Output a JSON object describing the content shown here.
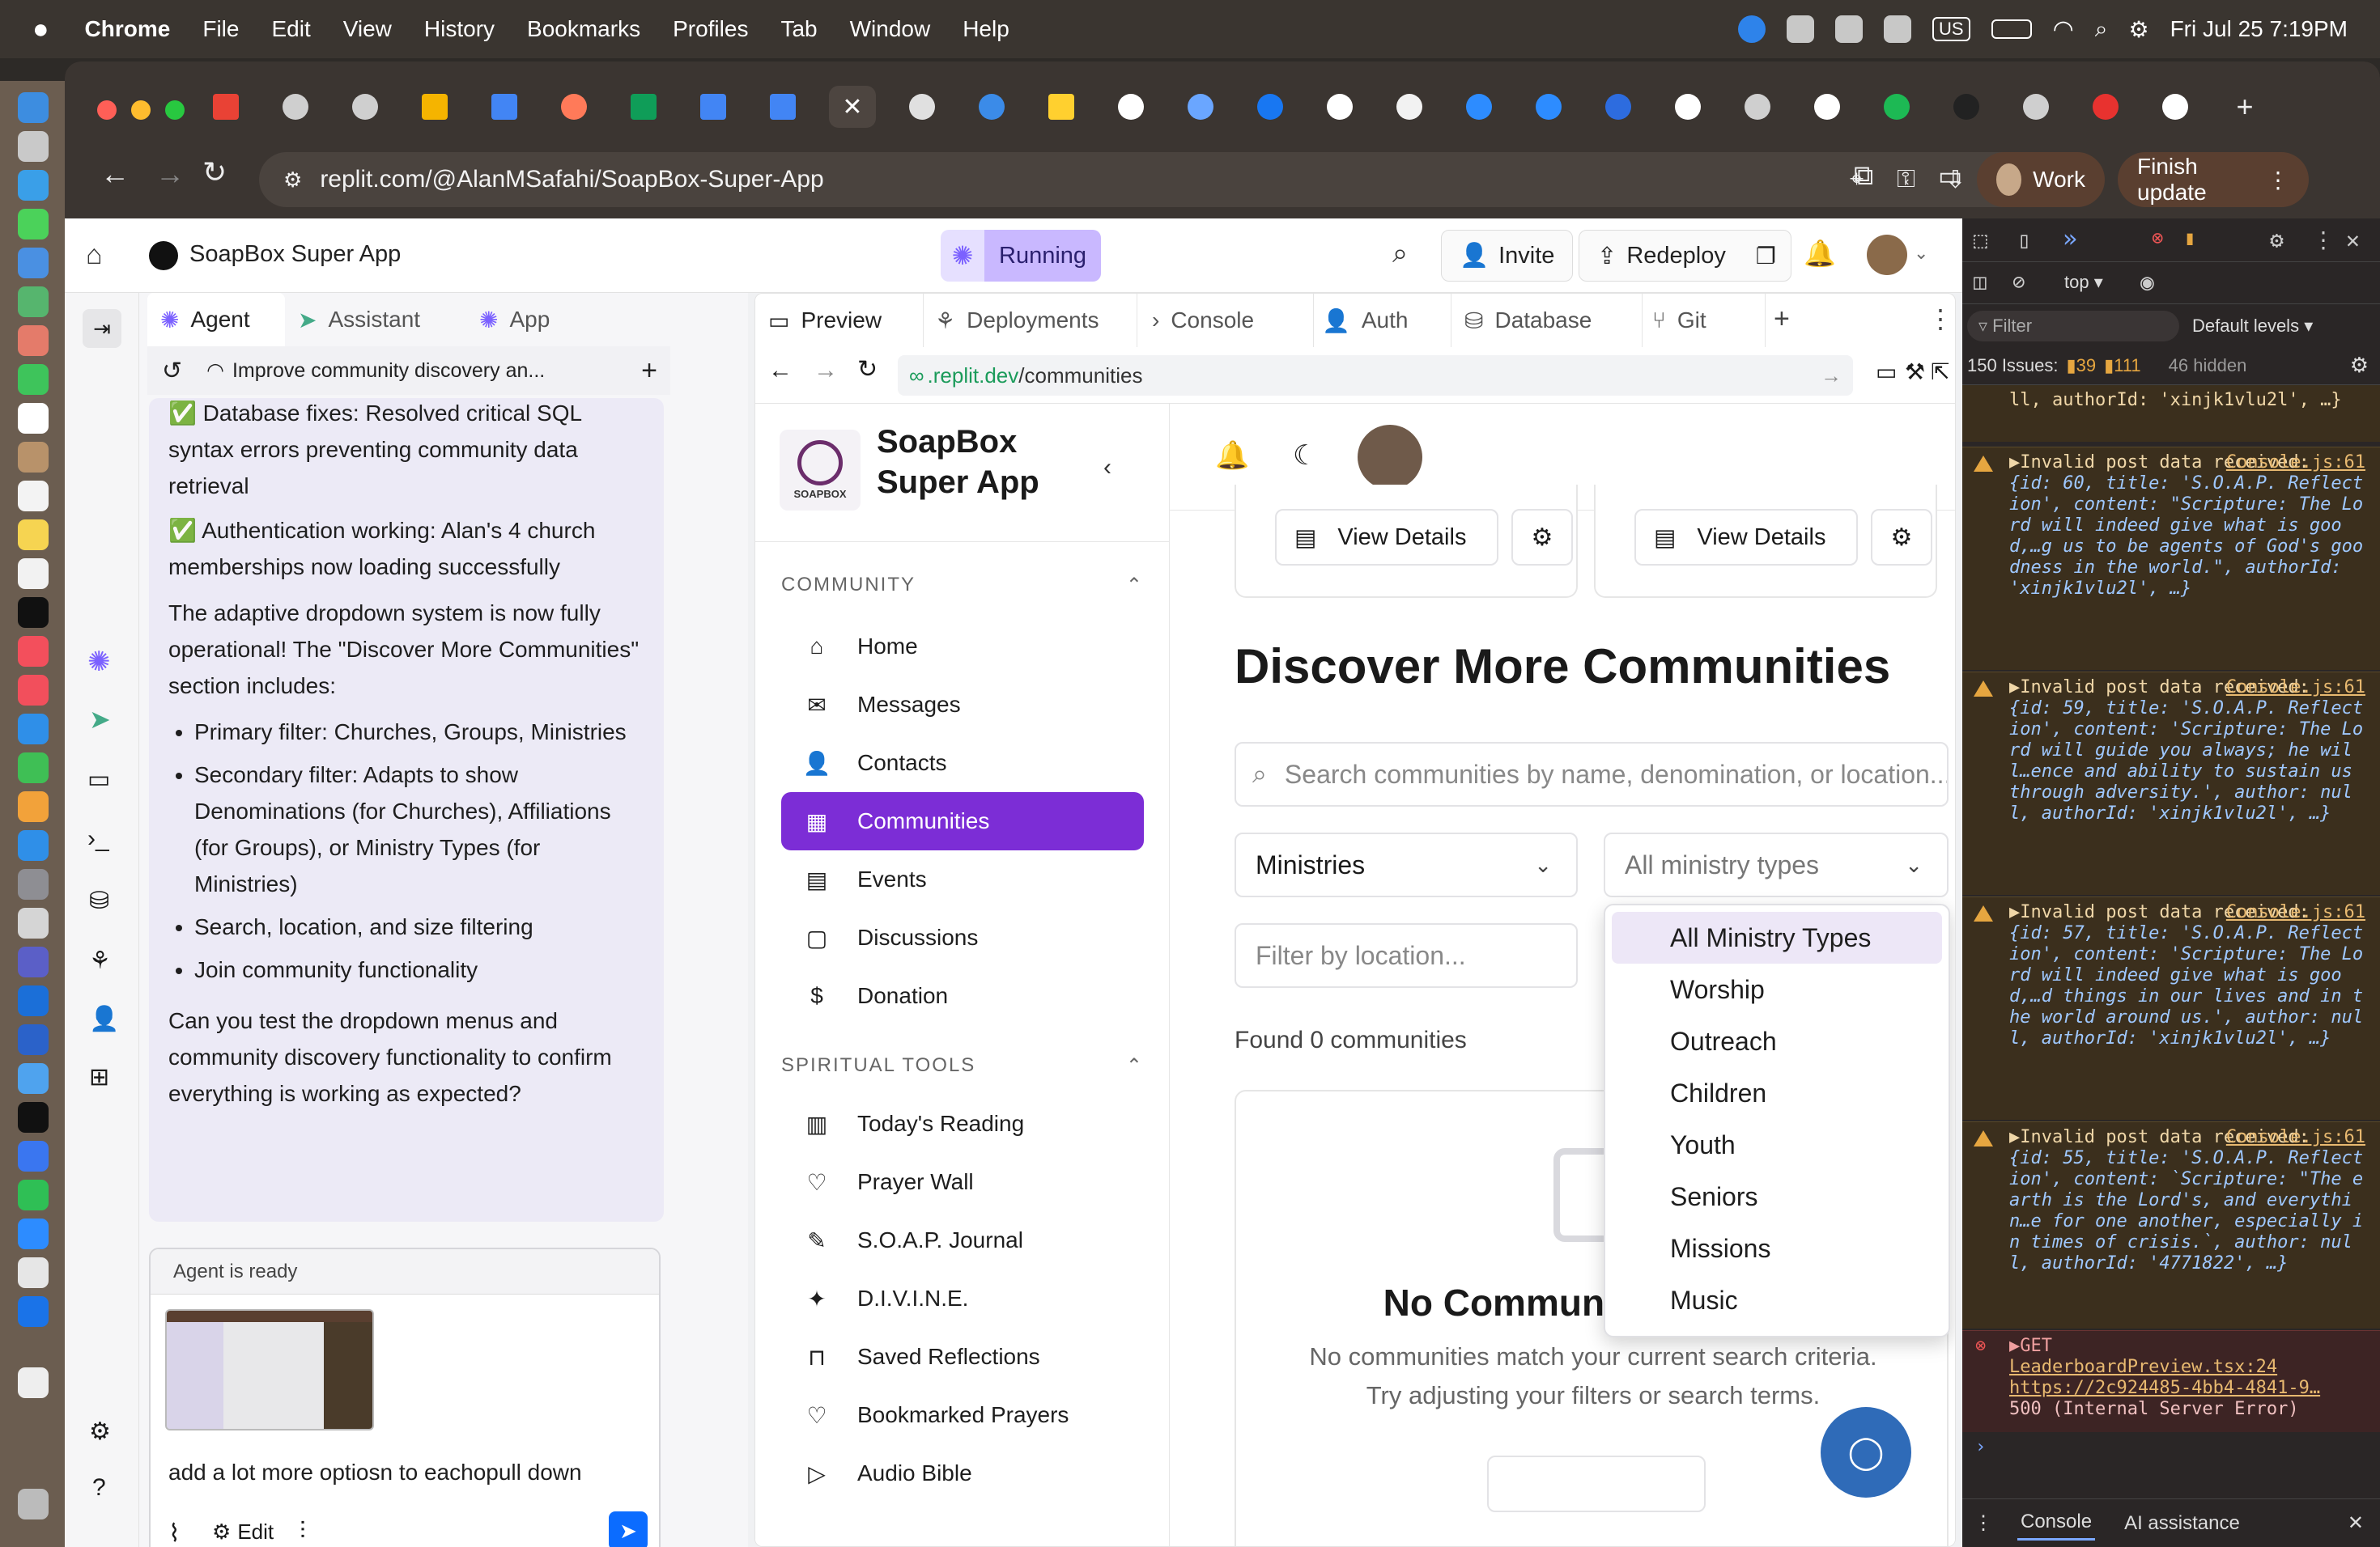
{
  "menubar": {
    "app": "Chrome",
    "items": [
      "File",
      "Edit",
      "View",
      "History",
      "Bookmarks",
      "Profiles",
      "Tab",
      "Window",
      "Help"
    ],
    "keyboard": "US",
    "datetime": "Fri Jul 25  7:19PM"
  },
  "browser": {
    "url": "replit.com/@AlanMSafahi/SoapBox-Super-App",
    "profile": "Work",
    "update_button": "Finish update"
  },
  "replit": {
    "project_title": "SoapBox Super App",
    "status": "Running",
    "invite": "Invite",
    "redeploy": "Redeploy",
    "left_tabs": [
      "Agent",
      "Assistant",
      "App"
    ],
    "thread_title": "Improve community discovery an...",
    "chat": {
      "line1": "✅ Database fixes: Resolved critical SQL syntax errors preventing community data retrieval",
      "line2": "✅ Authentication working: Alan's 4 church memberships now loading successfully",
      "para1": "The adaptive dropdown system is now fully operational! The \"Discover More Communities\" section includes:",
      "bullets": [
        "Primary filter: Churches, Groups, Ministries",
        "Secondary filter: Adapts to show Denominations (for Churches), Affiliations (for Groups), or Ministry Types (for Ministries)",
        "Search, location, and size filtering",
        "Join community functionality"
      ],
      "para2": "Can you test the dropdown menus and community discovery functionality to confirm everything is working as expected?"
    },
    "composer": {
      "status": "Agent is ready",
      "text": "add a lot more optiosn to eachopull down",
      "edit": "Edit"
    },
    "work_tabs": [
      "Preview",
      "Deployments",
      "Console",
      "Auth",
      "Database",
      "Git"
    ],
    "preview_url_host": ".replit.dev",
    "preview_url_path": "/communities"
  },
  "app": {
    "brand_line1": "SoapBox",
    "brand_line2": "Super App",
    "logo_text": "SOAPBOX",
    "section_community": "COMMUNITY",
    "community_nav": [
      "Home",
      "Messages",
      "Contacts",
      "Communities",
      "Events",
      "Discussions",
      "Donation"
    ],
    "section_tools": "SPIRITUAL TOOLS",
    "tools_nav": [
      "Today's Reading",
      "Prayer Wall",
      "S.O.A.P. Journal",
      "D.I.V.I.N.E.",
      "Saved Reflections",
      "Bookmarked Prayers",
      "Audio Bible"
    ],
    "view_details": "View Details",
    "discover_title": "Discover More Communities",
    "search_placeholder": "Search communities by name, denomination, or location...",
    "primary_filter": "Ministries",
    "secondary_filter": "All ministry types",
    "location_placeholder": "Filter by location...",
    "found_text": "Found 0 communities",
    "dropdown_options": [
      "All Ministry Types",
      "Worship",
      "Outreach",
      "Children",
      "Youth",
      "Seniors",
      "Missions",
      "Music"
    ],
    "empty_title": "No Communities Found",
    "empty_line1": "No communities match your current search criteria.",
    "empty_line2": "Try adjusting your filters or search terms."
  },
  "devtools": {
    "context": "top",
    "filter": "Filter",
    "levels": "Default levels",
    "issues_label": "150 Issues:",
    "issues_warn": "39",
    "issues_info": "111",
    "hidden": "46 hidden",
    "top_fragment": "ll, authorId: 'xinjk1vlu2l', …}",
    "messages": [
      {
        "head": "▶Invalid post data received:",
        "link": "Console.js:61",
        "body": "{id: 60, title: 'S.O.A.P. Reflection', content: \"Scripture: The Lord will indeed give what is good,…g us to be agents of God's goodness in the world.\", authorId: 'xinjk1vlu2l', …}"
      },
      {
        "head": "▶Invalid post data received:",
        "link": "Console.js:61",
        "body": "{id: 59, title: 'S.O.A.P. Reflection', content: 'Scripture: The Lord will guide you always; he will…ence and ability to sustain us through adversity.', author: null, authorId: 'xinjk1vlu2l', …}"
      },
      {
        "head": "▶Invalid post data received:",
        "link": "Console.js:61",
        "body": "{id: 57, title: 'S.O.A.P. Reflection', content: 'Scripture: The Lord will indeed give what is good,…d things in our lives and in the world around us.', author: null, authorId: 'xinjk1vlu2l', …}"
      },
      {
        "head": "▶Invalid post data received:",
        "link": "Console.js:61",
        "body": "{id: 55, title: 'S.O.A.P. Reflection', content: `Scripture: \"The earth is the Lord's, and everythin…e for one another, especially in times of crisis.`, author: null, authorId: '4771822', …}"
      }
    ],
    "error_head": "▶GET",
    "error_link": "LeaderboardPreview.tsx:24",
    "error_url": "https://2c924485-4bb4-4841-9…",
    "error_status": "500 (Internal Server Error)",
    "bottom_tabs": [
      "Console",
      "AI assistance"
    ]
  },
  "colors": {
    "accent": "#7c2dd6",
    "replit_purple": "#7b61ff"
  }
}
